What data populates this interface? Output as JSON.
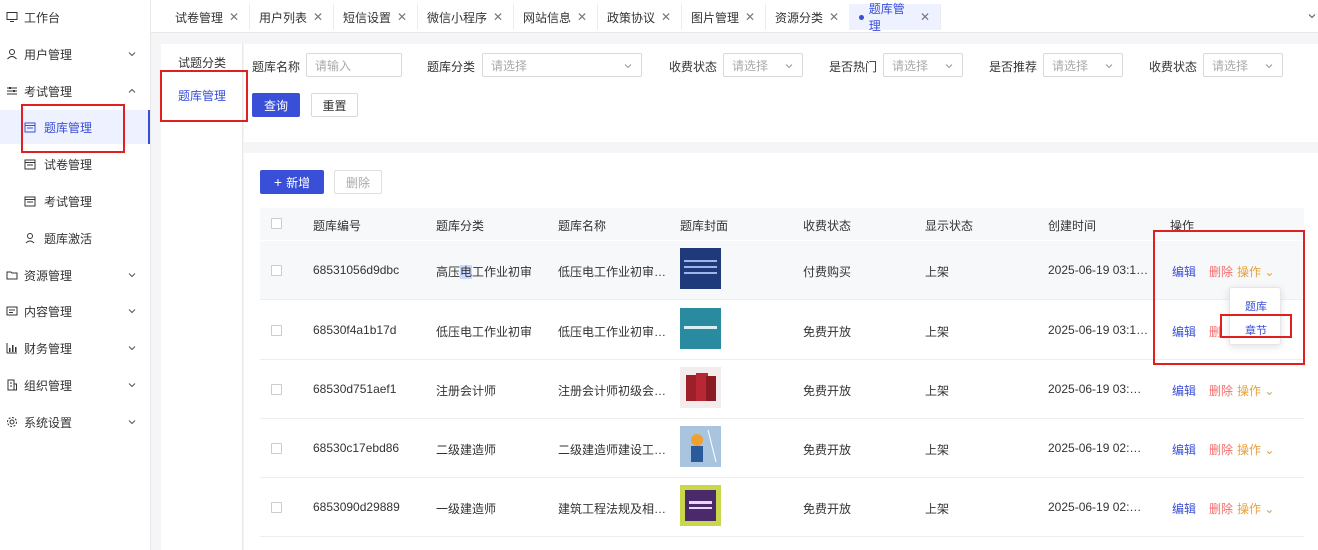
{
  "sidebar": {
    "items": [
      {
        "label": "工作台",
        "icon": "monitor-icon"
      },
      {
        "label": "用户管理",
        "icon": "user-icon"
      },
      {
        "label": "考试管理",
        "icon": "sliders-icon"
      },
      {
        "label": "资源管理",
        "icon": "folder-icon"
      },
      {
        "label": "内容管理",
        "icon": "content-icon"
      },
      {
        "label": "财务管理",
        "icon": "chart-icon"
      },
      {
        "label": "组织管理",
        "icon": "building-icon"
      },
      {
        "label": "系统设置",
        "icon": "gear-icon"
      }
    ],
    "sub_items": [
      {
        "label": "题库管理",
        "icon": "calendar-icon"
      },
      {
        "label": "试卷管理",
        "icon": "calendar-icon"
      },
      {
        "label": "考试管理",
        "icon": "calendar-icon"
      },
      {
        "label": "题库激活",
        "icon": "person-icon"
      }
    ]
  },
  "tabs": [
    {
      "label": "试卷管理"
    },
    {
      "label": "用户列表"
    },
    {
      "label": "短信设置"
    },
    {
      "label": "微信小程序"
    },
    {
      "label": "网站信息"
    },
    {
      "label": "政策协议"
    },
    {
      "label": "图片管理"
    },
    {
      "label": "资源分类"
    },
    {
      "label": "题库管理"
    }
  ],
  "category_panel": {
    "items": [
      "试题分类",
      "题库管理"
    ]
  },
  "search": {
    "name_label": "题库名称",
    "name_placeholder": "请输入",
    "category_label": "题库分类",
    "category_placeholder": "请选择",
    "fee_label": "收费状态",
    "fee_placeholder": "请选择",
    "hot_label": "是否热门",
    "hot_placeholder": "请选择",
    "recommend_label": "是否推荐",
    "recommend_placeholder": "请选择",
    "fee2_label": "收费状态",
    "fee2_placeholder": "请选择",
    "query_label": "查询",
    "reset_label": "重置"
  },
  "toolbar": {
    "add_label": "新增",
    "delete_label": "删除"
  },
  "table": {
    "headers": [
      "题库编号",
      "题库分类",
      "题库名称",
      "题库封面",
      "收费状态",
      "显示状态",
      "创建时间",
      "操作"
    ],
    "rows": [
      {
        "id": "68531056d9dbc",
        "category_pre": "高压",
        "category_sel": "电",
        "category_post": "工作业初审",
        "name": "低压电工作业初审…",
        "fee": "付费购买",
        "display": "上架",
        "created": "2025-06-19 03:1…"
      },
      {
        "id": "68530f4a1b17d",
        "category_pre": "低压电工作业初审",
        "category_sel": "",
        "category_post": "",
        "name": "低压电工作业初审…",
        "fee": "免费开放",
        "display": "上架",
        "created": "2025-06-19 03:1…"
      },
      {
        "id": "68530d751aef1",
        "category_pre": "注册会计师",
        "category_sel": "",
        "category_post": "",
        "name": "注册会计师初级会…",
        "fee": "免费开放",
        "display": "上架",
        "created": "2025-06-19 03:…"
      },
      {
        "id": "68530c17ebd86",
        "category_pre": "二级建造师",
        "category_sel": "",
        "category_post": "",
        "name": "二级建造师建设工…",
        "fee": "免费开放",
        "display": "上架",
        "created": "2025-06-19 02:…"
      },
      {
        "id": "6853090d29889",
        "category_pre": "一级建造师",
        "category_sel": "",
        "category_post": "",
        "name": "建筑工程法规及相…",
        "fee": "免费开放",
        "display": "上架",
        "created": "2025-06-19 02:…"
      }
    ],
    "ops": {
      "edit": "编辑",
      "delete": "删除",
      "more": "操作",
      "more_short": "删"
    }
  },
  "dropdown": {
    "items": [
      "题库",
      "章节"
    ]
  },
  "colors": {
    "primary": "#3a4fd8",
    "danger": "#f56c6c",
    "warning": "#e6a23c",
    "annotation": "#e02020"
  }
}
